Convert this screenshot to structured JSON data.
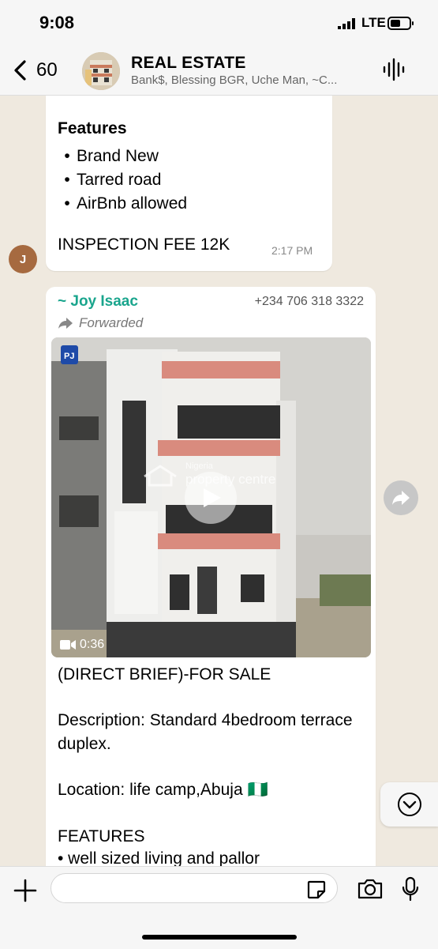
{
  "status": {
    "time": "9:08",
    "network": "LTE"
  },
  "header": {
    "back_count": "60",
    "title": "REAL ESTATE",
    "subtitle": "Bank$, Blessing BGR, Uche Man, ~C..."
  },
  "message1": {
    "features_title": "Features",
    "features": [
      "Brand New",
      "Tarred road",
      "AirBnb allowed"
    ],
    "inspection": "INSPECTION FEE 12K",
    "time": "2:17 PM",
    "sender_initial": "J"
  },
  "message2": {
    "sender": "~ Joy Isaac",
    "phone": "+234 706 318 3322",
    "forwarded": "Forwarded",
    "video_duration": "0:36",
    "watermark_title": "Nigeria",
    "watermark_text": "property centre",
    "brief": "(DIRECT BRIEF)-FOR SALE",
    "description": "Description:  Standard 4bedroom terrace duplex.",
    "location": "Location: life camp,Abuja 🇳🇬",
    "features_heading": "FEATURES",
    "next_line": "•  well sized living and pallor"
  },
  "colors": {
    "sender_name": "#1aa58d",
    "background": "#efe9df",
    "accent_avatar": "#a66a40"
  }
}
